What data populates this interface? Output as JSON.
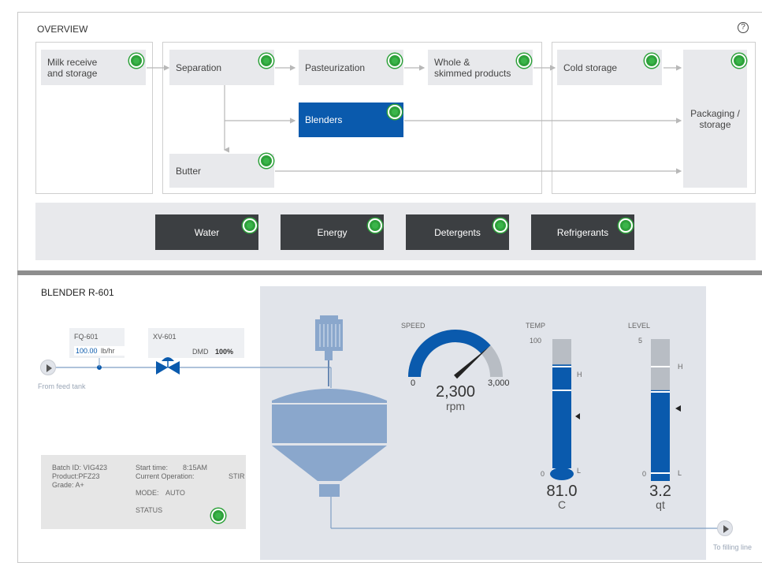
{
  "overview": {
    "title": "OVERVIEW",
    "help_icon": "question-circle-icon",
    "nodes": {
      "milk": "Milk receive\nand storage",
      "separation": "Separation",
      "pasteurization": "Pasteurization",
      "whole": "Whole &\nskimmed products",
      "cold": "Cold storage",
      "packaging": "Packaging  /\nstorage",
      "blenders": "Blenders",
      "butter": "Butter"
    },
    "utilities": [
      "Water",
      "Energy",
      "Detergents",
      "Refrigerants"
    ],
    "status_color": "#2ea13b",
    "selected_color": "#0a5aad"
  },
  "blender": {
    "title": "BLENDER R-601",
    "fq": {
      "tag": "FQ-601",
      "value": "100.00",
      "unit": "lb/hr"
    },
    "xv": {
      "tag": "XV-601",
      "dmd_label": "DMD",
      "dmd_value": "100%"
    },
    "from_label": "From feed tank",
    "to_label": "To filling line",
    "speed": {
      "label": "SPEED",
      "min": "0",
      "max": "3,000",
      "value": "2,300",
      "unit": "rpm",
      "fraction": 0.767
    },
    "temp": {
      "label": "TEMP",
      "max": "100",
      "min": "0",
      "h": "H",
      "l": "L",
      "value": "81.0",
      "unit": "C",
      "fraction": 0.81
    },
    "level": {
      "label": "LEVEL",
      "max": "5",
      "min": "0",
      "h": "H",
      "l": "L",
      "value": "3.2",
      "unit": "qt",
      "fraction": 0.64
    },
    "info": {
      "batch": "Batch ID: VIG423",
      "product": "Product:PFZ23",
      "grade": "Grade: A+",
      "start_label": "Start time:",
      "start_value": "8:15AM",
      "op_label": "Current Operation:",
      "op_value": "STIR",
      "mode_label": "MODE:",
      "mode_value": "AUTO",
      "status_label": "STATUS"
    }
  }
}
